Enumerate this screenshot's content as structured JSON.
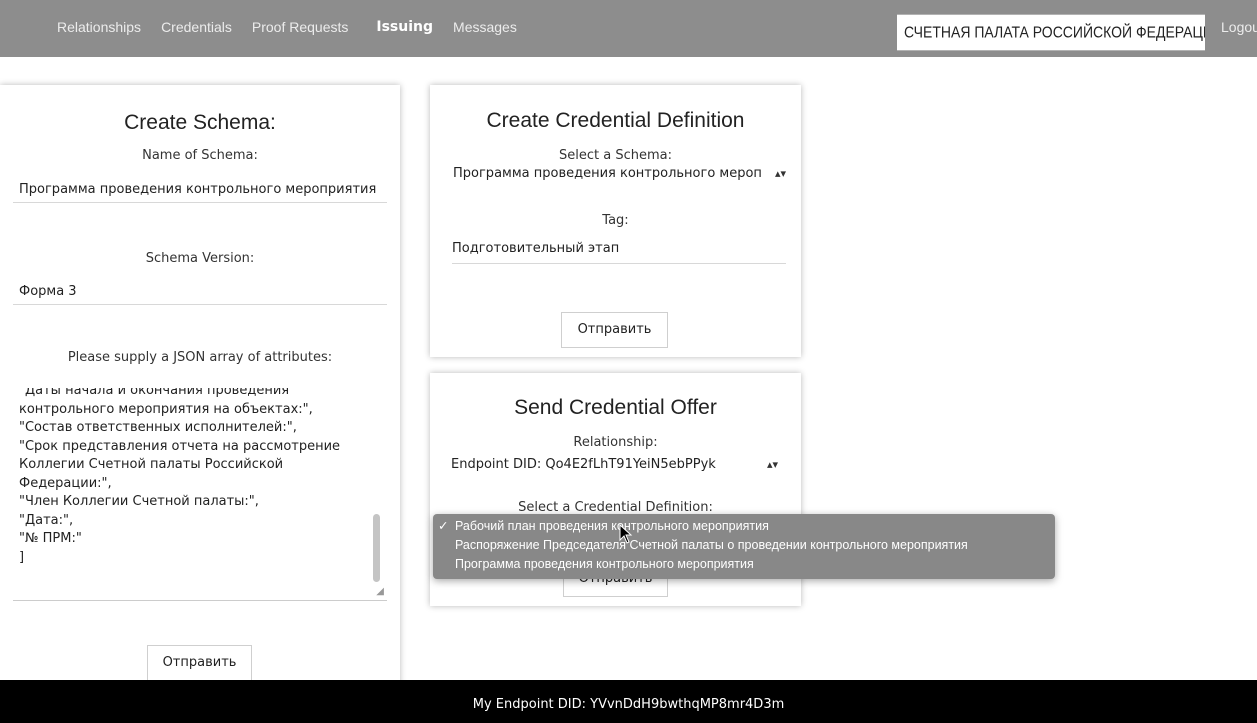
{
  "nav": {
    "links": [
      "Relationships",
      "Credentials",
      "Proof Requests",
      "Issuing",
      "Messages"
    ],
    "active": "Issuing",
    "organization": "СЧЕТНАЯ ПАЛАТА РОССИЙСКОЙ ФЕДЕРАЦИИ",
    "logout": "Logout"
  },
  "schema": {
    "title": "Create Schema:",
    "name_label": "Name of Schema:",
    "name_value": "Программа проведения контрольного мероприятия",
    "version_label": "Schema Version:",
    "version_value": "Форма 3",
    "json_label": "Please supply a JSON array of attributes:",
    "json_value": "\"Даты начала и окончания проведения\nконтрольного мероприятия на объектах:\",\n\"Состав ответственных исполнителей:\",\n\"Срок представления отчета на рассмотрение\nКоллегии Счетной палаты Российской\nФедерации:\",\n\"Член Коллегии Счетной палаты:\",\n\"Дата:\",\n\"№ ПРМ:\"\n]",
    "submit": "Отправить"
  },
  "cred_def": {
    "title": "Create Credential Definition",
    "schema_label": "Select a Schema:",
    "schema_selected": "Программа проведения контрольного мероп",
    "tag_label": "Tag:",
    "tag_value": "Подготовительный этап",
    "submit": "Отправить"
  },
  "offer": {
    "title": "Send Credential Offer",
    "relationship_label": "Relationship:",
    "relationship_selected": "Endpoint DID: Qo4E2fLhT91YeiN5ebPPyk",
    "cred_def_label": "Select a Credential Definition:",
    "submit": "Отправить",
    "options": [
      "Рабочий план проведения контрольного мероприятия",
      "Распоряжение Председателя Счетной палаты о проведении контрольного мероприятия",
      "Программа проведения контрольного мероприятия"
    ],
    "selected_index": 0
  },
  "footer": {
    "text": "My Endpoint DID: YVvnDdH9bwthqMP8mr4D3m"
  },
  "icons": {
    "select": "select-arrows-icon",
    "check": "checkmark-icon",
    "cursor": "mouse-pointer-icon",
    "grip": "resize-grip-icon"
  },
  "colors": {
    "nav_bg": "#8d8d8d",
    "footer_bg": "#000000",
    "dropdown_bg": "#888888"
  }
}
